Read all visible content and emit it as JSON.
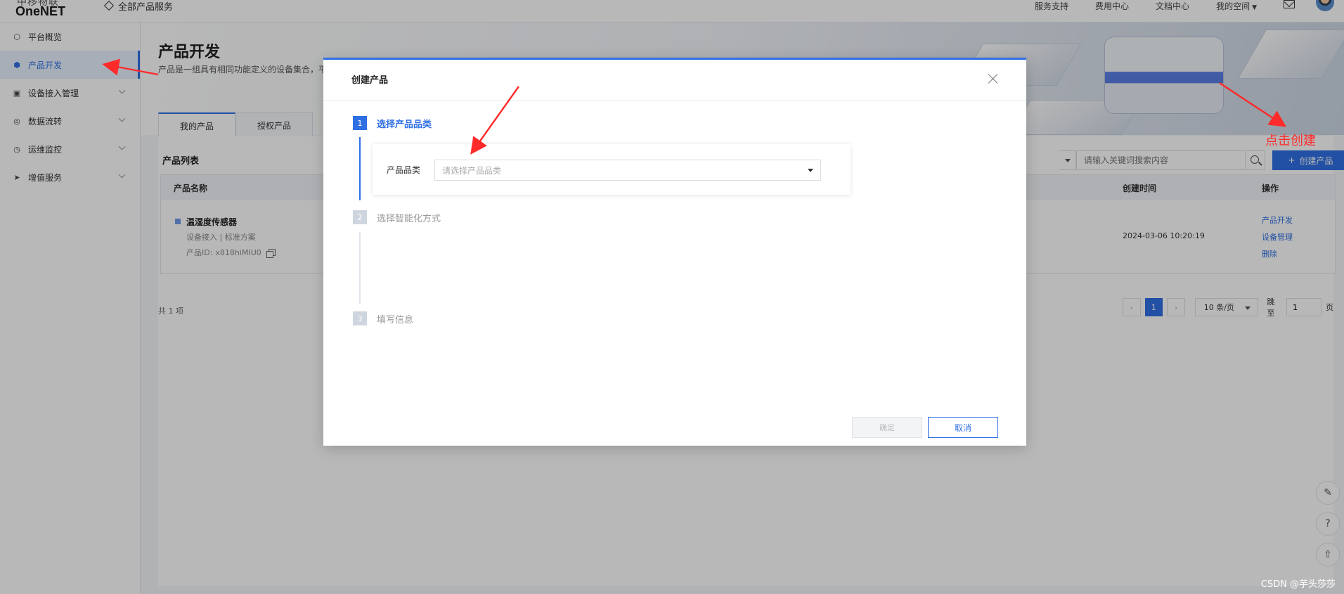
{
  "topbar": {
    "logo_top": "中移物联",
    "logo_name": "OneNET",
    "all_products": "全部产品服务",
    "links": [
      "服务支持",
      "费用中心",
      "文档中心",
      "我的空间"
    ]
  },
  "sidebar": {
    "items": [
      {
        "label": "平台概览",
        "icon": "overview-icon"
      },
      {
        "label": "产品开发",
        "icon": "cube-icon"
      },
      {
        "label": "设备接入管理",
        "icon": "device-icon"
      },
      {
        "label": "数据流转",
        "icon": "dataflow-icon"
      },
      {
        "label": "运维监控",
        "icon": "monitor-icon"
      },
      {
        "label": "增值服务",
        "icon": "send-icon"
      }
    ]
  },
  "main": {
    "title": "产品开发",
    "desc": "产品是一组具有相同功能定义的设备集合，平",
    "tabs": [
      "我的产品",
      "授权产品"
    ],
    "list_title": "产品列表",
    "search_placeholder": "请输入关键词搜索内容",
    "create_label": "创建产品",
    "table": {
      "headers": {
        "name": "产品名称",
        "time": "创建时间",
        "ops": "操作"
      },
      "rows": [
        {
          "name": "温湿度传感器",
          "sub": "设备接入  |  标准方案",
          "pid_label": "产品ID:",
          "pid": "x818hiMIU0",
          "time": "2024-03-06 10:20:19",
          "ops": [
            "产品开发",
            "设备管理",
            "删除"
          ]
        }
      ]
    },
    "total": "共 1 项",
    "pager": {
      "current": "1",
      "size": "10 条/页",
      "jump_label": "跳至",
      "jump_value": "1",
      "page_suffix": "页"
    }
  },
  "modal": {
    "title": "创建产品",
    "steps": [
      {
        "num": "1",
        "label": "选择产品品类"
      },
      {
        "num": "2",
        "label": "选择智能化方式"
      },
      {
        "num": "3",
        "label": "填写信息"
      }
    ],
    "field_label": "产品品类",
    "field_placeholder": "请选择产品品类",
    "confirm_label": "确定",
    "cancel_label": "取消"
  },
  "annotation": {
    "text": "点击创建",
    "color": "#ff2a2a"
  },
  "watermark": "CSDN @芋头莎莎",
  "colors": {
    "accent": "#2f6fe4",
    "annotation": "#ff2a2a"
  }
}
